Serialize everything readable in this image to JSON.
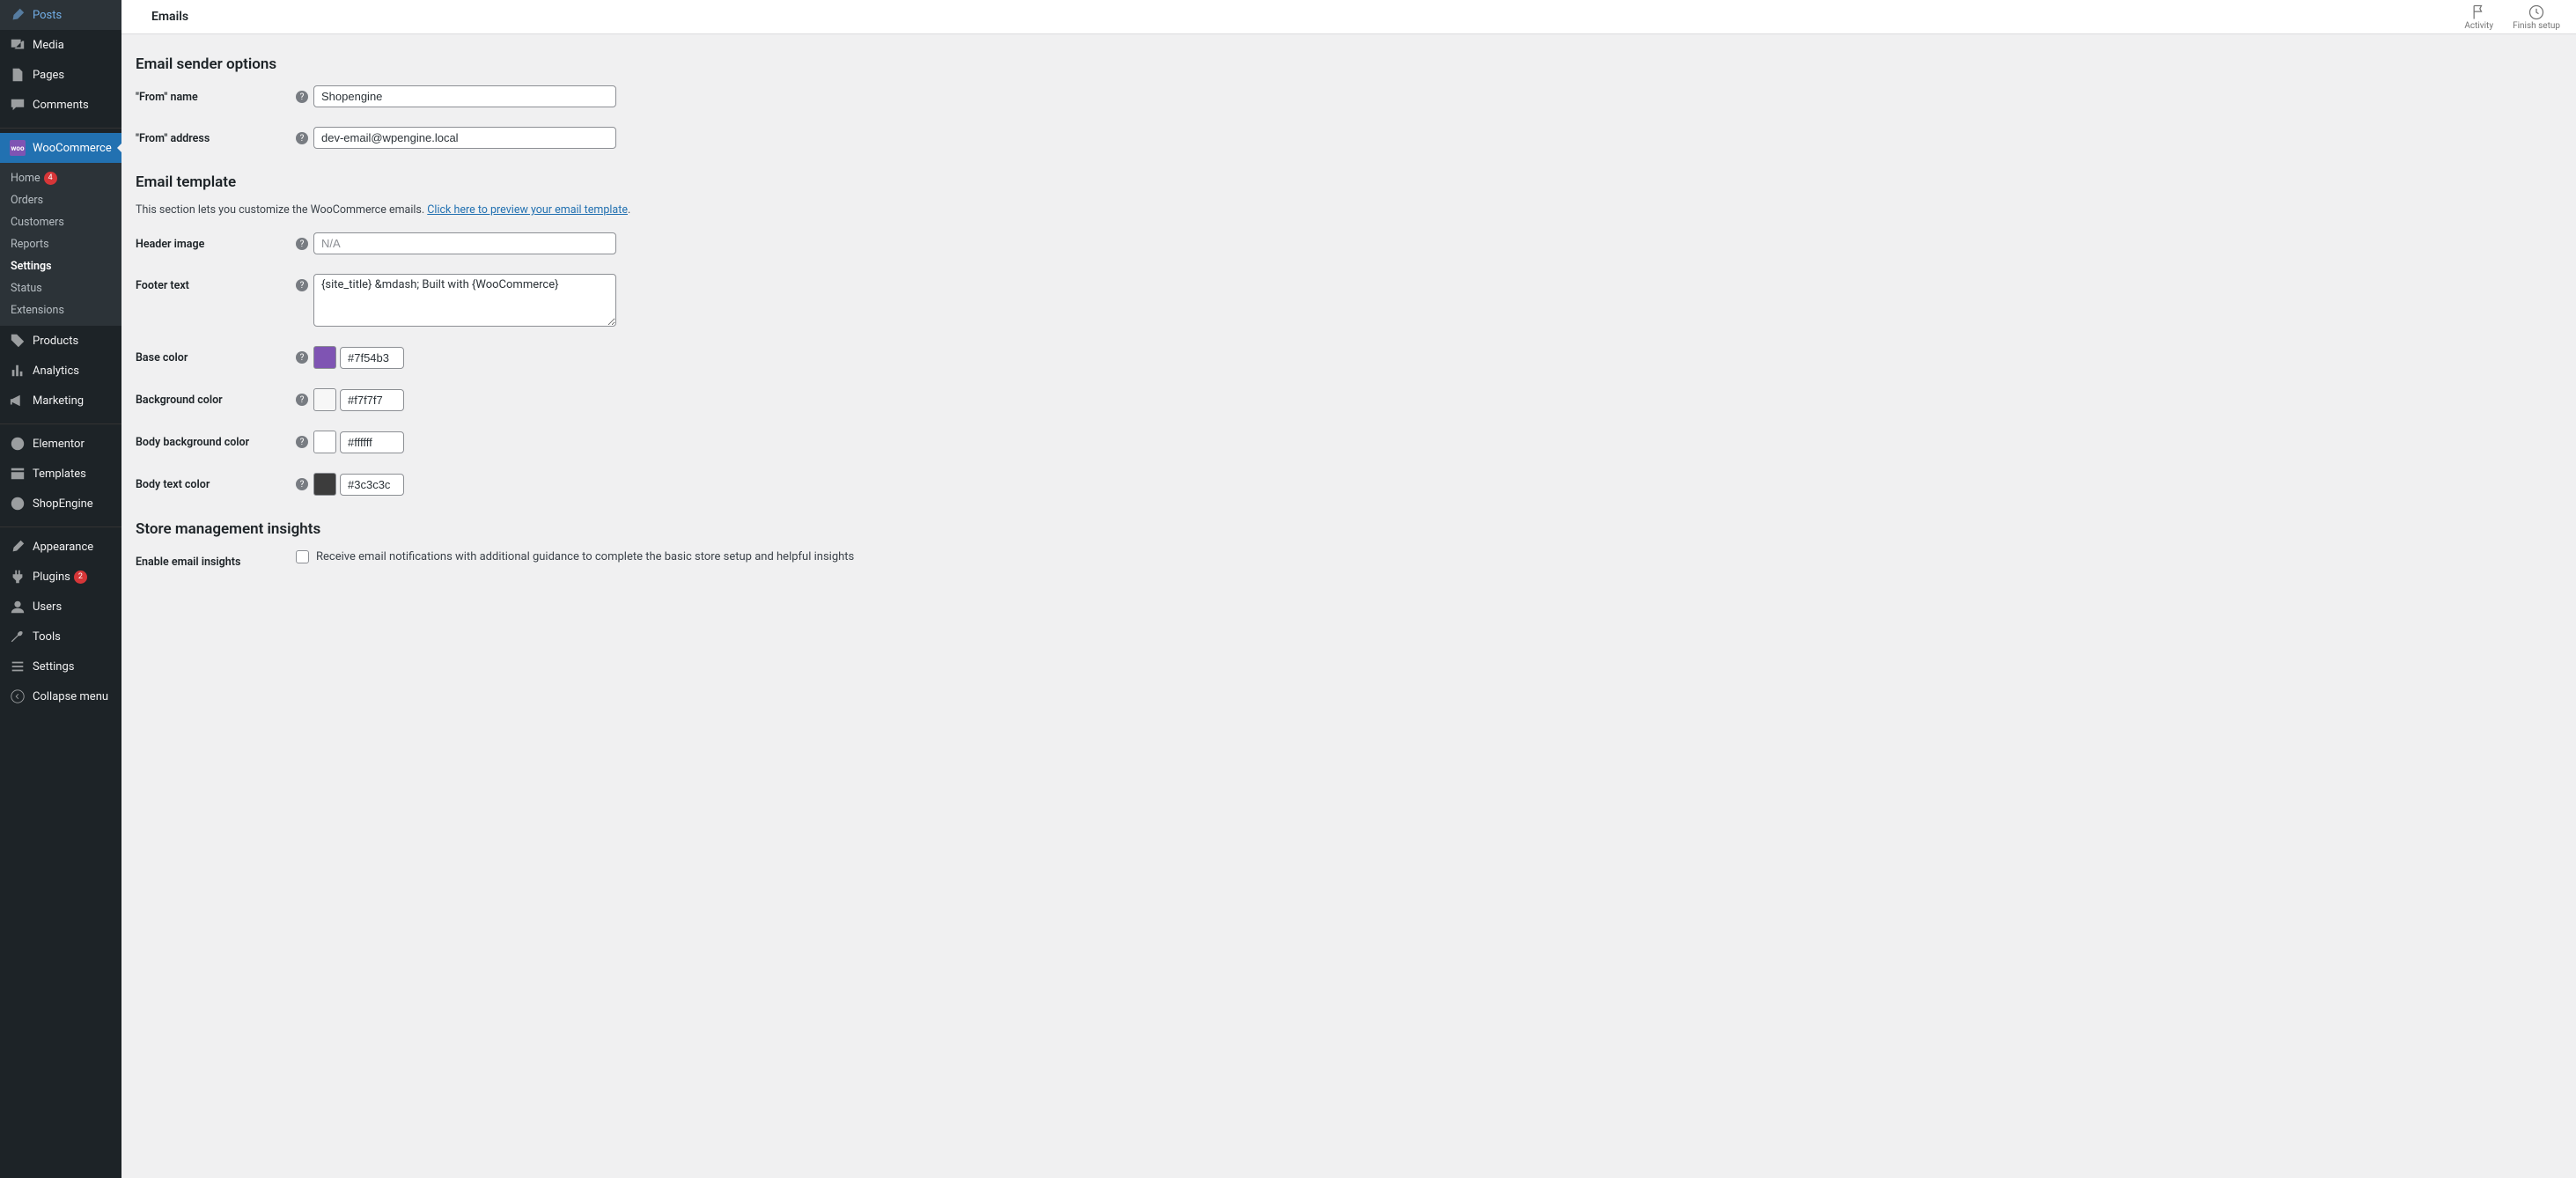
{
  "topbar": {
    "title": "Emails",
    "activity": "Activity",
    "finish_setup": "Finish setup"
  },
  "sidebar": {
    "posts": "Posts",
    "media": "Media",
    "pages": "Pages",
    "comments": "Comments",
    "woocommerce": "WooCommerce",
    "products": "Products",
    "analytics": "Analytics",
    "marketing": "Marketing",
    "elementor": "Elementor",
    "templates": "Templates",
    "shopengine": "ShopEngine",
    "appearance": "Appearance",
    "plugins": "Plugins",
    "users": "Users",
    "tools": "Tools",
    "settings": "Settings",
    "collapse": "Collapse menu",
    "plugins_badge": "2",
    "sub": {
      "home": "Home",
      "home_badge": "4",
      "orders": "Orders",
      "customers": "Customers",
      "reports": "Reports",
      "settings": "Settings",
      "status": "Status",
      "extensions": "Extensions"
    }
  },
  "sections": {
    "sender": {
      "title": "Email sender options",
      "from_name_label": "\"From\" name",
      "from_name_value": "Shopengine",
      "from_address_label": "\"From\" address",
      "from_address_value": "dev-email@wpengine.local"
    },
    "template": {
      "title": "Email template",
      "desc_plain": "This section lets you customize the WooCommerce emails. ",
      "desc_link": "Click here to preview your email template",
      "desc_end": ".",
      "header_image_label": "Header image",
      "header_image_placeholder": "N/A",
      "footer_text_label": "Footer text",
      "footer_text_value": "{site_title} &mdash; Built with {WooCommerce}",
      "base_color_label": "Base color",
      "base_color_value": "#7f54b3",
      "background_color_label": "Background color",
      "background_color_value": "#f7f7f7",
      "body_bg_label": "Body background color",
      "body_bg_value": "#ffffff",
      "body_text_label": "Body text color",
      "body_text_value": "#3c3c3c"
    },
    "insights": {
      "title": "Store management insights",
      "enable_label": "Enable email insights",
      "enable_desc": "Receive email notifications with additional guidance to complete the basic store setup and helpful insights"
    }
  }
}
